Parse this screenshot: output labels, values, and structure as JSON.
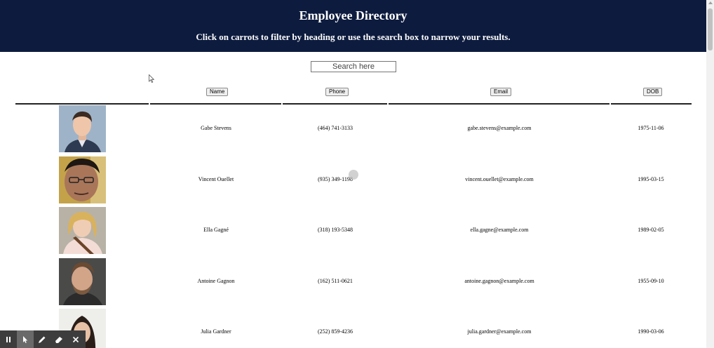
{
  "header": {
    "title": "Employee Directory",
    "subtitle": "Click on carrots to filter by heading or use the search box to narrow your results."
  },
  "search": {
    "placeholder": "Search here"
  },
  "columns": {
    "name": "Name",
    "phone": "Phone",
    "email": "Email",
    "dob": "DOB"
  },
  "employees": [
    {
      "name": "Gabe Stevens",
      "phone": "(464) 741-3133",
      "email": "gabe.stevens@example.com",
      "dob": "1975-11-06"
    },
    {
      "name": "Vincent Ouellet",
      "phone": "(935) 349-1198",
      "email": "vincent.ouellet@example.com",
      "dob": "1995-03-15"
    },
    {
      "name": "Ella Gagné",
      "phone": "(318) 193-5348",
      "email": "ella.gagne@example.com",
      "dob": "1989-02-05"
    },
    {
      "name": "Antoine Gagnon",
      "phone": "(162) 511-0621",
      "email": "antoine.gagnon@example.com",
      "dob": "1955-09-10"
    },
    {
      "name": "Julia Gardner",
      "phone": "(252) 859-4236",
      "email": "julia.gardner@example.com",
      "dob": "1990-03-06"
    }
  ],
  "toolbar": {
    "tools": [
      "pause-icon",
      "pointer-icon",
      "pen-icon",
      "eraser-icon",
      "close-icon"
    ]
  }
}
